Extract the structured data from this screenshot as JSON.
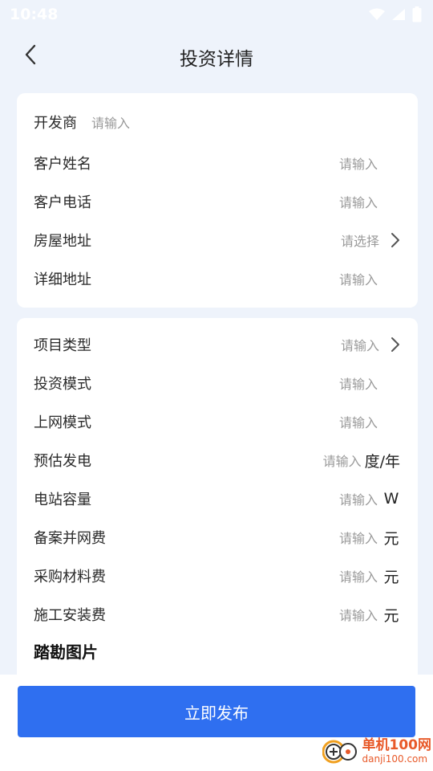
{
  "status_bar": {
    "time": "10:48"
  },
  "nav": {
    "title": "投资详情"
  },
  "card1": {
    "developer": {
      "label": "开发商",
      "placeholder": "请输入"
    },
    "rows": [
      {
        "label": "客户姓名",
        "placeholder": "请输入"
      },
      {
        "label": "客户电话",
        "placeholder": "请输入"
      },
      {
        "label": "房屋地址",
        "placeholder": "请选择"
      },
      {
        "label": "详细地址",
        "placeholder": "请输入"
      }
    ]
  },
  "card2": {
    "rows": [
      {
        "label": "项目类型",
        "placeholder": "请输入"
      },
      {
        "label": "投资模式",
        "placeholder": "请输入"
      },
      {
        "label": "上网模式",
        "placeholder": "请输入"
      },
      {
        "label": "预估发电",
        "placeholder": "请输入",
        "unit": "度/年"
      },
      {
        "label": "电站容量",
        "placeholder": "请输入",
        "unit": "W"
      },
      {
        "label": "备案并网费",
        "placeholder": "请输入",
        "unit": "元"
      },
      {
        "label": "采购材料费",
        "placeholder": "请输入",
        "unit": "元"
      },
      {
        "label": "施工安装费",
        "placeholder": "请输入",
        "unit": "元"
      }
    ],
    "section_title": "踏勘图片"
  },
  "footer": {
    "publish_label": "立即发布"
  },
  "watermark": {
    "cn": "单机100网",
    "en": "danji100.com"
  },
  "colors": {
    "background": "#eef3fb",
    "primary": "#2f6ff0",
    "placeholder": "#9a9a9a",
    "watermark": "#e85a2a"
  }
}
